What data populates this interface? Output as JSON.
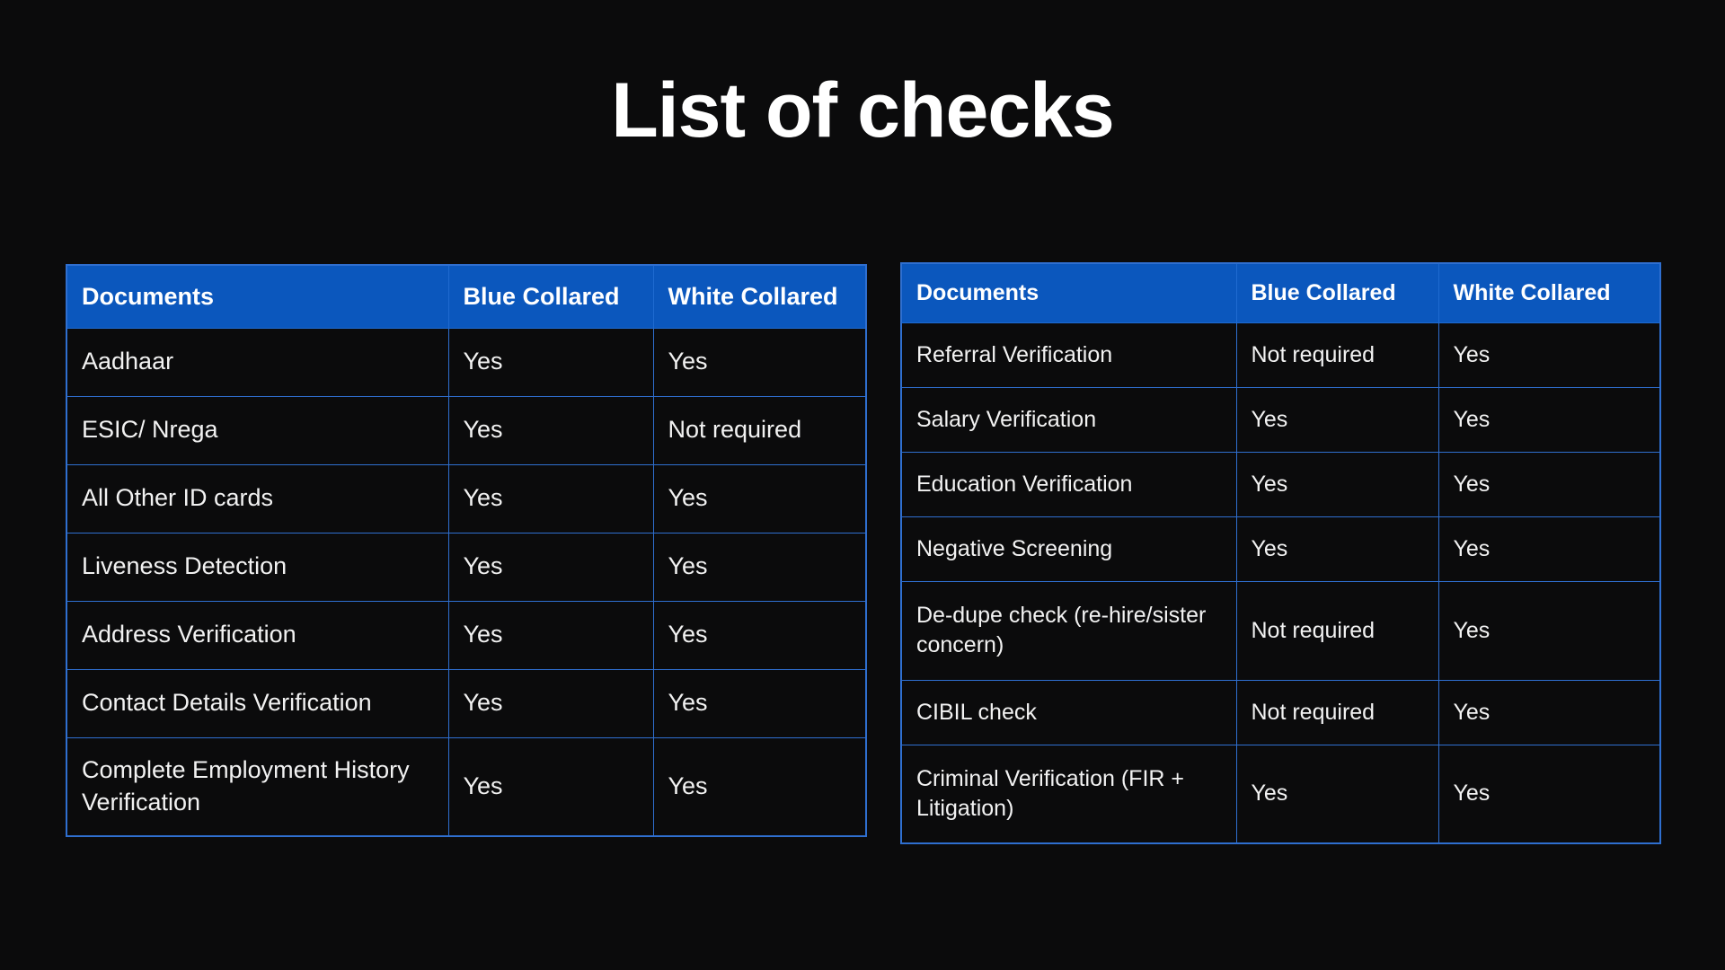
{
  "slide": {
    "title": "List of checks",
    "background_color": "#0b0b0c",
    "header_color": "#0b57bd",
    "border_color": "#2f6fd0",
    "text_color": "#ffffff"
  },
  "tables": [
    {
      "id": "left",
      "name": "documents-checks-table-left",
      "columns": [
        "Documents",
        "Blue Collared",
        "White Collared"
      ],
      "rows": [
        {
          "document": "Aadhaar",
          "blue_collared": "Yes",
          "white_collared": "Yes"
        },
        {
          "document": "ESIC/ Nrega",
          "blue_collared": "Yes",
          "white_collared": "Not required"
        },
        {
          "document": "All Other ID cards",
          "blue_collared": "Yes",
          "white_collared": "Yes"
        },
        {
          "document": "Liveness Detection",
          "blue_collared": "Yes",
          "white_collared": "Yes"
        },
        {
          "document": "Address Verification",
          "blue_collared": "Yes",
          "white_collared": "Yes"
        },
        {
          "document": "Contact Details Verification",
          "blue_collared": "Yes",
          "white_collared": "Yes"
        },
        {
          "document": "Complete Employment History Verification",
          "blue_collared": "Yes",
          "white_collared": "Yes"
        }
      ]
    },
    {
      "id": "right",
      "name": "documents-checks-table-right",
      "columns": [
        "Documents",
        "Blue Collared",
        "White Collared"
      ],
      "rows": [
        {
          "document": "Referral Verification",
          "blue_collared": "Not required",
          "white_collared": "Yes"
        },
        {
          "document": "Salary Verification",
          "blue_collared": "Yes",
          "white_collared": "Yes"
        },
        {
          "document": "Education Verification",
          "blue_collared": "Yes",
          "white_collared": "Yes"
        },
        {
          "document": "Negative Screening",
          "blue_collared": "Yes",
          "white_collared": "Yes"
        },
        {
          "document": "De-dupe check (re-hire/sister concern)",
          "blue_collared": "Not required",
          "white_collared": "Yes"
        },
        {
          "document": "CIBIL check",
          "blue_collared": "Not required",
          "white_collared": "Yes"
        },
        {
          "document": "Criminal Verification (FIR + Litigation)",
          "blue_collared": "Yes",
          "white_collared": "Yes"
        }
      ]
    }
  ]
}
